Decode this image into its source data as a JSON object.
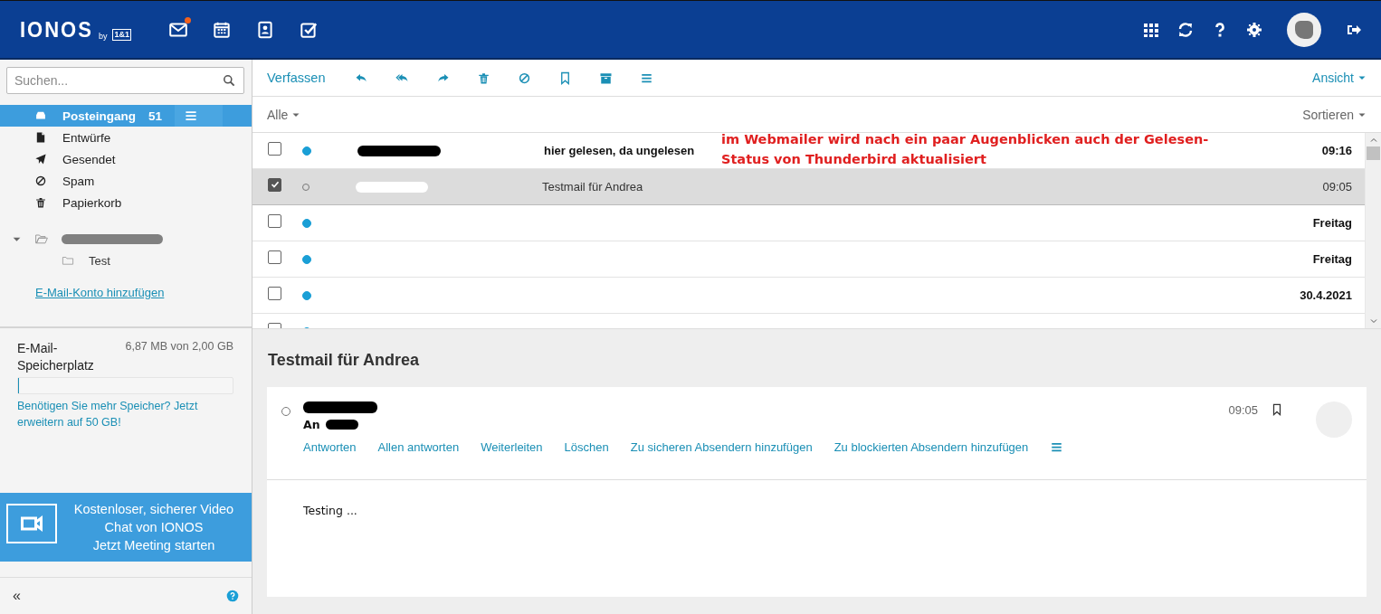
{
  "header": {
    "logo": "IONOS",
    "logo_by": "by",
    "logo_badge": "1&1",
    "nav": [
      {
        "kind": "mail",
        "notification": true
      },
      {
        "kind": "calendar",
        "notification": false
      },
      {
        "kind": "contacts",
        "notification": false
      },
      {
        "kind": "tasks",
        "notification": false
      }
    ]
  },
  "sidebar": {
    "search": {
      "placeholder": "Suchen..."
    },
    "folders": [
      {
        "kind": "inbox",
        "label": "Posteingang",
        "count": "51",
        "selected": true
      },
      {
        "kind": "drafts",
        "label": "Entwürfe",
        "selected": false
      },
      {
        "kind": "sent",
        "label": "Gesendet",
        "selected": false
      },
      {
        "kind": "spam",
        "label": "Spam",
        "selected": false
      },
      {
        "kind": "trash",
        "label": "Papierkorb",
        "selected": false
      }
    ],
    "account": {
      "expanded": true,
      "children": [
        {
          "label": "Test"
        }
      ]
    },
    "add_account_link": "E-Mail-Konto hinzufügen",
    "storage": {
      "label": "E-Mail-Speicherplatz",
      "usage": "6,87 MB von 2,00 GB",
      "level": 0.004,
      "upsell": "Benötigen Sie mehr Speicher? Jetzt erweitern auf 50 GB!"
    },
    "promo": {
      "lines": [
        "Kostenloser, sicherer Video",
        "Chat von IONOS",
        "Jetzt Meeting starten"
      ]
    },
    "footer": {
      "collapse": "«"
    }
  },
  "toolbar": {
    "compose": "Verfassen",
    "view": "Ansicht"
  },
  "list_header": {
    "filter": "Alle",
    "sort": "Sortieren"
  },
  "messages": [
    {
      "checked": false,
      "selected": false,
      "unread": true,
      "sender_redacted": true,
      "subject": "hier gelesen, da ungelesen",
      "time": "09:16"
    },
    {
      "checked": true,
      "selected": true,
      "unread": false,
      "sender_redacted": true,
      "subject": "Testmail für Andrea",
      "time": "09:05"
    },
    {
      "checked": false,
      "selected": false,
      "unread": true,
      "sender_redacted": false,
      "time": "Freitag"
    },
    {
      "checked": false,
      "selected": false,
      "unread": true,
      "sender_redacted": false,
      "time": "Freitag"
    },
    {
      "checked": false,
      "selected": false,
      "unread": true,
      "sender_redacted": false,
      "time": "30.4.2021"
    },
    {
      "checked": false,
      "selected": false,
      "unread": true,
      "sender_redacted": false
    }
  ],
  "annotation": "im Webmailer wird nach ein paar Augenblicken auch der Gelesen-Status von Thunderbird aktualisiert",
  "preview": {
    "subject": "Testmail für Andrea",
    "unread": false,
    "recipient_label": "An",
    "time": "09:05",
    "actions": [
      "Antworten",
      "Allen antworten",
      "Weiterleiten",
      "Löschen",
      "Zu sicheren Absendern hinzufügen",
      "Zu blockierten Absendern hinzufügen"
    ],
    "body": "Testing ..."
  }
}
